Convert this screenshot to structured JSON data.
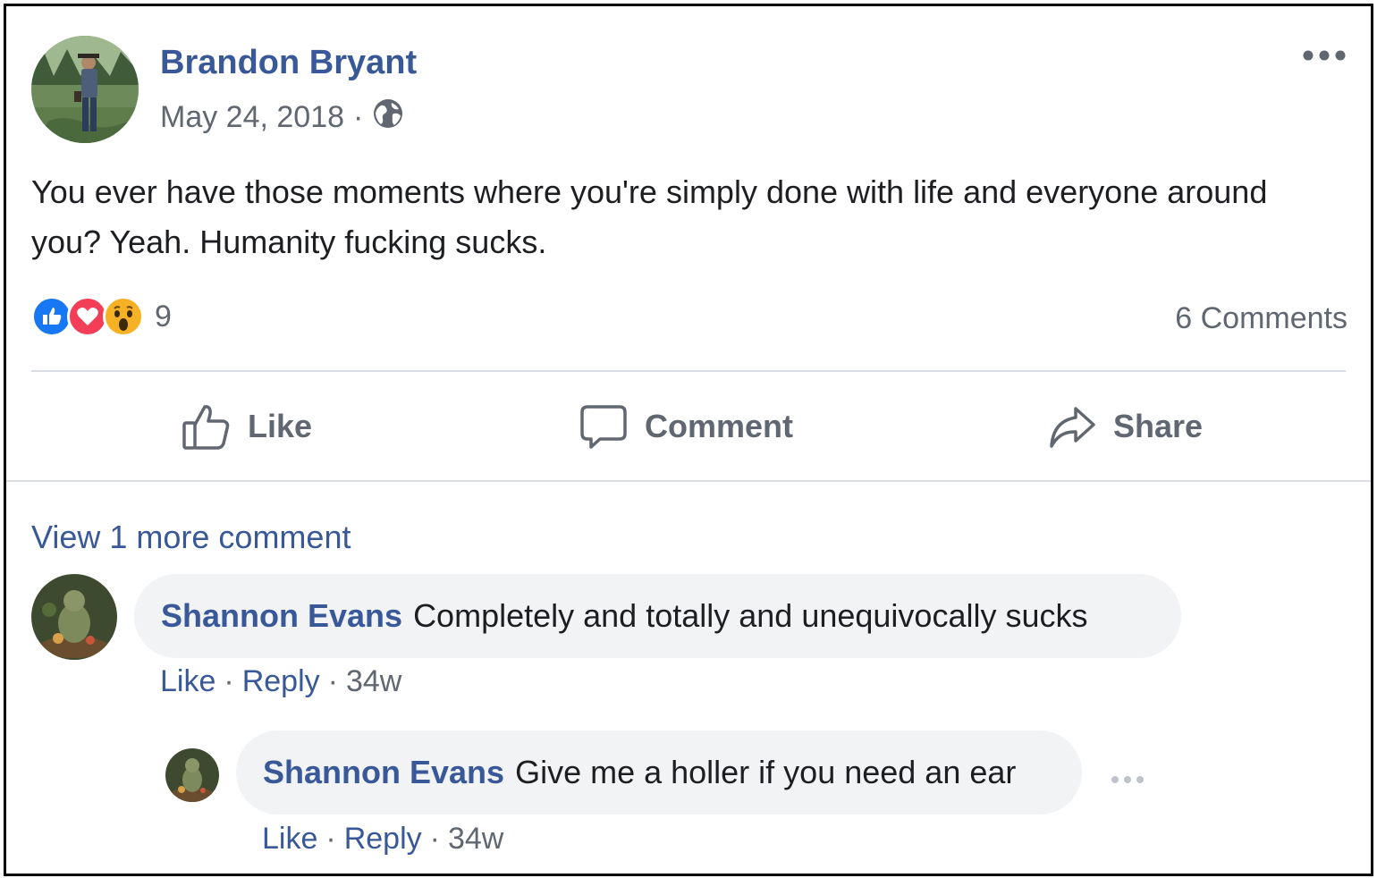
{
  "post": {
    "author": "Brandon Bryant",
    "date": "May 24, 2018",
    "date_separator": "·",
    "privacy_icon": "globe-icon",
    "text": "You ever have those moments where you're simply done with life and everyone around you? Yeah. Humanity fucking sucks.",
    "reactions": {
      "types": [
        "like",
        "love",
        "wow"
      ],
      "count": "9"
    },
    "comments_count": "6 Comments"
  },
  "actions": {
    "like": "Like",
    "comment": "Comment",
    "share": "Share"
  },
  "comments": {
    "view_more": "View 1 more comment",
    "items": [
      {
        "name": "Shannon Evans",
        "text": "Completely and totally and unequivocally sucks",
        "like": "Like",
        "reply": "Reply",
        "age": "34w",
        "sep": "·"
      },
      {
        "name": "Shannon Evans",
        "text": "Give me a holler if you need an ear",
        "like": "Like",
        "reply": "Reply",
        "age": "34w",
        "sep": "·"
      }
    ]
  },
  "colors": {
    "link_blue": "#385898",
    "secondary_text": "#606770",
    "like_blue": "#1877f2",
    "love_red": "#f33e58",
    "wow_yellow": "#f7b125",
    "bubble_bg": "#f2f3f5"
  }
}
